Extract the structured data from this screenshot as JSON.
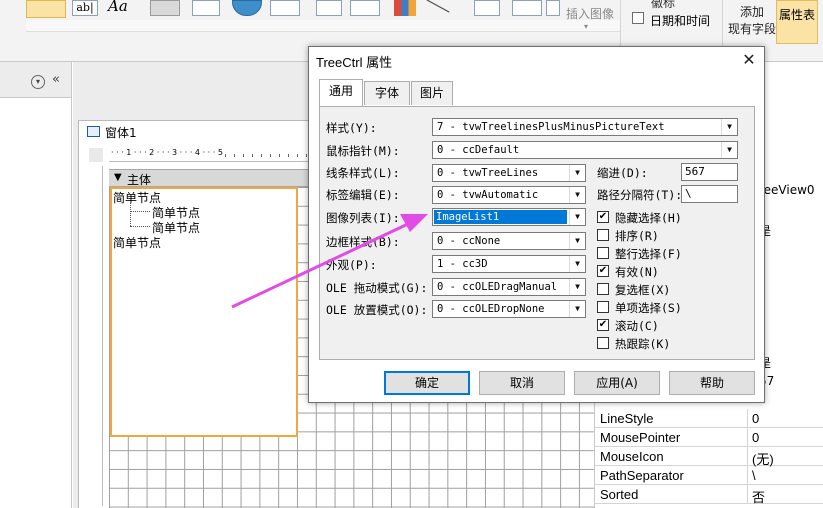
{
  "ribbon": {
    "insert_image": "插入图像",
    "logo_partial": "徽标",
    "datetime": "日期和时间",
    "add_existing_fields": "添加\n现有字段",
    "property_sheet": "属性表"
  },
  "form": {
    "tab_title": "窗体1",
    "section_label": "主体",
    "ruler_top": "· · · 1 · · · 2 · · · 3 · · · 4 · · · 5",
    "tree_nodes": [
      "简单节点",
      "简单节点",
      "简单节点",
      "简单节点"
    ]
  },
  "properties": {
    "fragments": [
      "reeView0",
      "是",
      "是",
      "57"
    ],
    "rows": [
      {
        "name": "LineStyle",
        "value": "0"
      },
      {
        "name": "MousePointer",
        "value": "0"
      },
      {
        "name": "MouseIcon",
        "value": "(无)"
      },
      {
        "name": "PathSeparator",
        "value": "\\"
      },
      {
        "name": "Sorted",
        "value": "否"
      }
    ]
  },
  "dialog": {
    "title": "TreeCtrl 属性",
    "close_glyph": "✕",
    "tabs": [
      "通用",
      "字体",
      "图片"
    ],
    "fields": {
      "style": {
        "label": "样式(Y):",
        "value": "7 - tvwTreelinesPlusMinusPictureText"
      },
      "mouse_pointer": {
        "label": "鼠标指针(M):",
        "value": "0 - ccDefault"
      },
      "line_style": {
        "label": "线条样式(L):",
        "value": "0 - tvwTreeLines"
      },
      "label_edit": {
        "label": "标签编辑(E):",
        "value": "0 - tvwAutomatic"
      },
      "image_list": {
        "label": "图像列表(I):",
        "value": "ImageList1"
      },
      "border_style": {
        "label": "边框样式(B):",
        "value": "0 - ccNone"
      },
      "appearance": {
        "label": "外观(P):",
        "value": "1 - cc3D"
      },
      "ole_drag": {
        "label": "OLE 拖动模式(G):",
        "value": "0 - ccOLEDragManual"
      },
      "ole_drop": {
        "label": "OLE 放置模式(O):",
        "value": "0 - ccOLEDropNone"
      },
      "indent": {
        "label": "缩进(D):",
        "value": "567"
      },
      "path_sep": {
        "label": "路径分隔符(T):",
        "value": "\\"
      }
    },
    "checkboxes": [
      {
        "label": "隐藏选择(H)",
        "checked": true
      },
      {
        "label": "排序(R)",
        "checked": false
      },
      {
        "label": "整行选择(F)",
        "checked": false
      },
      {
        "label": "有效(N)",
        "checked": true
      },
      {
        "label": "复选框(X)",
        "checked": false
      },
      {
        "label": "单项选择(S)",
        "checked": false
      },
      {
        "label": "滚动(C)",
        "checked": true
      },
      {
        "label": "热跟踪(K)",
        "checked": false
      }
    ],
    "buttons": {
      "ok": "确定",
      "cancel": "取消",
      "apply": "应用(A)",
      "help": "帮助"
    },
    "dropdown_glyph": "▼",
    "check_glyph": "✔"
  },
  "colors": {
    "accent": "#0078d7",
    "annotation": "#e24be6",
    "selection_outline": "#f2a640"
  }
}
